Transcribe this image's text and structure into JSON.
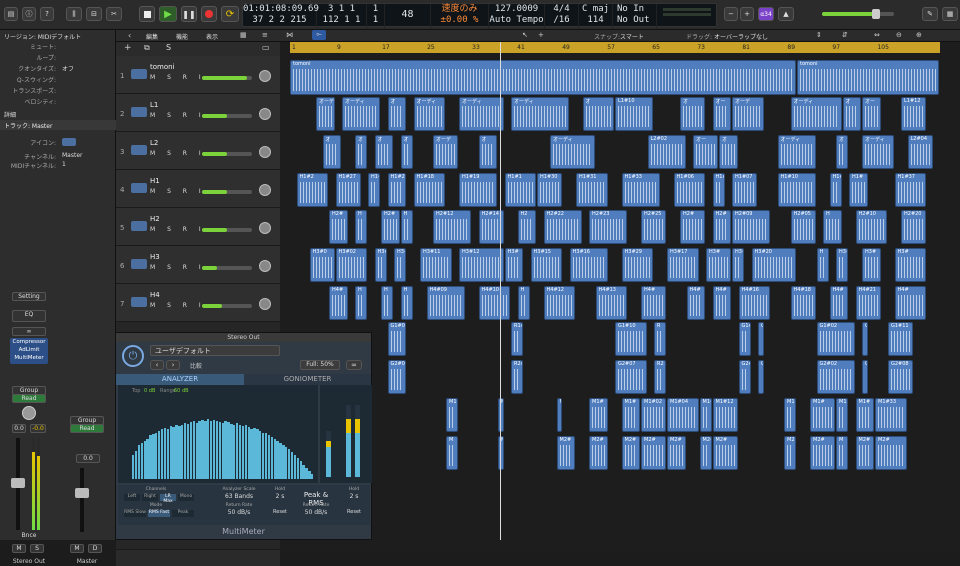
{
  "toolbar": {
    "transport": [
      "stop",
      "play",
      "pause",
      "record",
      "cycle"
    ],
    "lcd": {
      "smpte": "01:01:08:09.69",
      "bars": "37  2  2 215",
      "pos_top": "3  1  1",
      "pos_bottom": "112  1  1",
      "pos_extra_top": "1",
      "pos_extra_bottom": "1",
      "val": "48",
      "tempo_mode": "速度のみ",
      "tempo_offset": "±0.00 %",
      "tempo": "127.0009",
      "tempo_label": "Auto Tempo",
      "sig": "4/4",
      "div": "/16",
      "key": "C maj",
      "key_num": "114",
      "in": "No In",
      "out": "No Out"
    },
    "right_badge": "α34"
  },
  "menubar": {
    "items": [
      "編集",
      "機能",
      "表示"
    ],
    "snap_label": "スナップ:",
    "snap_value": "スマート",
    "drag_label": "ドラッグ:",
    "drag_value": "オーバーラップなし"
  },
  "ruler": {
    "ticks": [
      "1",
      "9",
      "17",
      "25",
      "33",
      "41",
      "49",
      "57",
      "65",
      "73",
      "81",
      "89",
      "97",
      "105"
    ]
  },
  "inspector": {
    "region_header": "リージョン: MIDIデフォルト",
    "rows": [
      {
        "k": "ミュート:",
        "v": ""
      },
      {
        "k": "ループ:",
        "v": ""
      },
      {
        "k": "クオンタイズ:",
        "v": "オフ"
      },
      {
        "k": "Q-スウィング:",
        "v": ""
      },
      {
        "k": "トランスポーズ:",
        "v": ""
      },
      {
        "k": "ベロシティ:",
        "v": ""
      }
    ],
    "more": "詳細",
    "track_header": "トラック: Master",
    "icon_label": "アイコン:",
    "channel_label": "チャンネル:",
    "channel_value": "Master",
    "midi_label": "MIDIチャンネル:",
    "midi_value": "1",
    "setting_btn": "Setting",
    "eq_btn": "EQ",
    "plugins": [
      "Compressor",
      "AdLimit",
      "MultiMeter"
    ],
    "strip1": {
      "group": "Group",
      "auto": "Read",
      "val1": "0.0",
      "val2": "-0.0",
      "bnce": "Bnce",
      "name": "Stereo Out",
      "m": "M",
      "s": "S"
    },
    "strip2": {
      "group": "Group",
      "auto": "Read",
      "val1": "0.0",
      "name": "Master",
      "m": "M",
      "d": "D"
    }
  },
  "tracks": [
    {
      "num": "1",
      "name": "tomoni",
      "vol": 0.9
    },
    {
      "num": "2",
      "name": "L1",
      "vol": 0.5
    },
    {
      "num": "3",
      "name": "L2",
      "vol": 0.5
    },
    {
      "num": "4",
      "name": "H1",
      "vol": 0.5
    },
    {
      "num": "5",
      "name": "H2",
      "vol": 0.5
    },
    {
      "num": "6",
      "name": "H3",
      "vol": 0.3
    },
    {
      "num": "7",
      "name": "H4",
      "vol": 0.4
    }
  ],
  "track_buttons": "M S R I",
  "regions": [
    {
      "lane": 0,
      "label": "tomoni",
      "start": 0.0,
      "end": 0.78
    },
    {
      "lane": 0,
      "label": "tomoni",
      "start": 0.78,
      "end": 1.0
    },
    {
      "lane": 1,
      "label": "オーデ",
      "start": 0.04,
      "end": 0.07
    },
    {
      "lane": 1,
      "label": "オーディ",
      "start": 0.08,
      "end": 0.14
    },
    {
      "lane": 1,
      "label": "オ",
      "start": 0.15,
      "end": 0.18
    },
    {
      "lane": 1,
      "label": "オーディ",
      "start": 0.19,
      "end": 0.24
    },
    {
      "lane": 1,
      "label": "オーディ",
      "start": 0.26,
      "end": 0.33
    },
    {
      "lane": 1,
      "label": "オーディ",
      "start": 0.34,
      "end": 0.43
    },
    {
      "lane": 1,
      "label": "オ",
      "start": 0.45,
      "end": 0.5
    },
    {
      "lane": 1,
      "label": "オーディ",
      "start": 0.51,
      "end": 0.56
    },
    {
      "lane": 1,
      "label": "L1#10",
      "start": 0.5,
      "end": 0.56
    },
    {
      "lane": 1,
      "label": "オ",
      "start": 0.6,
      "end": 0.64
    },
    {
      "lane": 1,
      "label": "オー",
      "start": 0.65,
      "end": 0.68
    },
    {
      "lane": 1,
      "label": "オーデ",
      "start": 0.68,
      "end": 0.73
    },
    {
      "lane": 1,
      "label": "オーディ",
      "start": 0.77,
      "end": 0.85
    },
    {
      "lane": 1,
      "label": "オ",
      "start": 0.85,
      "end": 0.88
    },
    {
      "lane": 1,
      "label": "オー",
      "start": 0.88,
      "end": 0.91
    },
    {
      "lane": 1,
      "label": "L1#12",
      "start": 0.94,
      "end": 0.98
    },
    {
      "lane": 2,
      "label": "オ",
      "start": 0.05,
      "end": 0.08
    },
    {
      "lane": 2,
      "label": "オ",
      "start": 0.1,
      "end": 0.12
    },
    {
      "lane": 2,
      "label": "オ",
      "start": 0.13,
      "end": 0.16
    },
    {
      "lane": 2,
      "label": "オ",
      "start": 0.17,
      "end": 0.19
    },
    {
      "lane": 2,
      "label": "オーデ",
      "start": 0.22,
      "end": 0.26
    },
    {
      "lane": 2,
      "label": "オ",
      "start": 0.29,
      "end": 0.32
    },
    {
      "lane": 2,
      "label": "オーディ",
      "start": 0.4,
      "end": 0.47
    },
    {
      "lane": 2,
      "label": "L2#02",
      "start": 0.55,
      "end": 0.61
    },
    {
      "lane": 2,
      "label": "オー",
      "start": 0.62,
      "end": 0.66
    },
    {
      "lane": 2,
      "label": "オ",
      "start": 0.66,
      "end": 0.69
    },
    {
      "lane": 2,
      "label": "オーディ",
      "start": 0.75,
      "end": 0.81
    },
    {
      "lane": 2,
      "label": "オ",
      "start": 0.84,
      "end": 0.86
    },
    {
      "lane": 2,
      "label": "オーディ",
      "start": 0.88,
      "end": 0.93
    },
    {
      "lane": 2,
      "label": "L2#04",
      "start": 0.95,
      "end": 0.99
    },
    {
      "lane": 3,
      "label": "H1#2",
      "start": 0.01,
      "end": 0.06
    },
    {
      "lane": 3,
      "label": "H1#27",
      "start": 0.07,
      "end": 0.11
    },
    {
      "lane": 3,
      "label": "H1#",
      "start": 0.12,
      "end": 0.14
    },
    {
      "lane": 3,
      "label": "H1#2",
      "start": 0.15,
      "end": 0.18
    },
    {
      "lane": 3,
      "label": "H1#18",
      "start": 0.19,
      "end": 0.24
    },
    {
      "lane": 3,
      "label": "H1#19",
      "start": 0.26,
      "end": 0.32
    },
    {
      "lane": 3,
      "label": "H1#1",
      "start": 0.33,
      "end": 0.38
    },
    {
      "lane": 3,
      "label": "H1#30",
      "start": 0.38,
      "end": 0.42
    },
    {
      "lane": 3,
      "label": "H1#31",
      "start": 0.44,
      "end": 0.49
    },
    {
      "lane": 3,
      "label": "H1#33",
      "start": 0.51,
      "end": 0.57
    },
    {
      "lane": 3,
      "label": "H1#06",
      "start": 0.59,
      "end": 0.64
    },
    {
      "lane": 3,
      "label": "H1#",
      "start": 0.65,
      "end": 0.67
    },
    {
      "lane": 3,
      "label": "H1#07",
      "start": 0.68,
      "end": 0.72
    },
    {
      "lane": 3,
      "label": "H1#10",
      "start": 0.75,
      "end": 0.81
    },
    {
      "lane": 3,
      "label": "H1#",
      "start": 0.83,
      "end": 0.85
    },
    {
      "lane": 3,
      "label": "H1#",
      "start": 0.86,
      "end": 0.89
    },
    {
      "lane": 3,
      "label": "H1#37",
      "start": 0.93,
      "end": 0.98
    },
    {
      "lane": 4,
      "label": "H2#",
      "start": 0.06,
      "end": 0.09
    },
    {
      "lane": 4,
      "label": "H",
      "start": 0.1,
      "end": 0.12
    },
    {
      "lane": 4,
      "label": "H2#",
      "start": 0.14,
      "end": 0.17
    },
    {
      "lane": 4,
      "label": "H",
      "start": 0.17,
      "end": 0.19
    },
    {
      "lane": 4,
      "label": "H2#12",
      "start": 0.22,
      "end": 0.28
    },
    {
      "lane": 4,
      "label": "H2#14",
      "start": 0.29,
      "end": 0.33
    },
    {
      "lane": 4,
      "label": "H2",
      "start": 0.35,
      "end": 0.38
    },
    {
      "lane": 4,
      "label": "H2#22",
      "start": 0.39,
      "end": 0.45
    },
    {
      "lane": 4,
      "label": "H2#23",
      "start": 0.46,
      "end": 0.52
    },
    {
      "lane": 4,
      "label": "H2#25",
      "start": 0.54,
      "end": 0.58
    },
    {
      "lane": 4,
      "label": "H2#",
      "start": 0.6,
      "end": 0.64
    },
    {
      "lane": 4,
      "label": "H2#",
      "start": 0.65,
      "end": 0.68
    },
    {
      "lane": 4,
      "label": "H2#09",
      "start": 0.68,
      "end": 0.74
    },
    {
      "lane": 4,
      "label": "H2#05",
      "start": 0.77,
      "end": 0.81
    },
    {
      "lane": 4,
      "label": "H",
      "start": 0.82,
      "end": 0.85
    },
    {
      "lane": 4,
      "label": "H2#10",
      "start": 0.87,
      "end": 0.92
    },
    {
      "lane": 4,
      "label": "H2#20",
      "start": 0.94,
      "end": 0.98
    },
    {
      "lane": 5,
      "label": "H3#0",
      "start": 0.03,
      "end": 0.07
    },
    {
      "lane": 5,
      "label": "H3#02",
      "start": 0.07,
      "end": 0.12
    },
    {
      "lane": 5,
      "label": "H3#",
      "start": 0.13,
      "end": 0.15
    },
    {
      "lane": 5,
      "label": "H3#",
      "start": 0.16,
      "end": 0.18
    },
    {
      "lane": 5,
      "label": "H3#11",
      "start": 0.2,
      "end": 0.25
    },
    {
      "lane": 5,
      "label": "H3#12",
      "start": 0.26,
      "end": 0.33
    },
    {
      "lane": 5,
      "label": "H3#",
      "start": 0.33,
      "end": 0.36
    },
    {
      "lane": 5,
      "label": "H3#15",
      "start": 0.37,
      "end": 0.42
    },
    {
      "lane": 5,
      "label": "H3#16",
      "start": 0.43,
      "end": 0.49
    },
    {
      "lane": 5,
      "label": "H3#29",
      "start": 0.51,
      "end": 0.56
    },
    {
      "lane": 5,
      "label": "H3#17",
      "start": 0.58,
      "end": 0.63
    },
    {
      "lane": 5,
      "label": "H3#",
      "start": 0.64,
      "end": 0.68
    },
    {
      "lane": 5,
      "label": "H3#",
      "start": 0.68,
      "end": 0.7
    },
    {
      "lane": 5,
      "label": "H3#20",
      "start": 0.71,
      "end": 0.78
    },
    {
      "lane": 5,
      "label": "H",
      "start": 0.81,
      "end": 0.83
    },
    {
      "lane": 5,
      "label": "H3#",
      "start": 0.84,
      "end": 0.86
    },
    {
      "lane": 5,
      "label": "H3#",
      "start": 0.88,
      "end": 0.91
    },
    {
      "lane": 5,
      "label": "H3#",
      "start": 0.93,
      "end": 0.98
    },
    {
      "lane": 6,
      "label": "H4#",
      "start": 0.06,
      "end": 0.09
    },
    {
      "lane": 6,
      "label": "H",
      "start": 0.1,
      "end": 0.12
    },
    {
      "lane": 6,
      "label": "H",
      "start": 0.14,
      "end": 0.16
    },
    {
      "lane": 6,
      "label": "H",
      "start": 0.17,
      "end": 0.19
    },
    {
      "lane": 6,
      "label": "H4#09",
      "start": 0.21,
      "end": 0.27
    },
    {
      "lane": 6,
      "label": "H4#10",
      "start": 0.29,
      "end": 0.34
    },
    {
      "lane": 6,
      "label": "H",
      "start": 0.35,
      "end": 0.37
    },
    {
      "lane": 6,
      "label": "H4#12",
      "start": 0.39,
      "end": 0.44
    },
    {
      "lane": 6,
      "label": "H4#13",
      "start": 0.47,
      "end": 0.52
    },
    {
      "lane": 6,
      "label": "H4#",
      "start": 0.54,
      "end": 0.58
    },
    {
      "lane": 6,
      "label": "H4#",
      "start": 0.61,
      "end": 0.64
    },
    {
      "lane": 6,
      "label": "H4#",
      "start": 0.65,
      "end": 0.68
    },
    {
      "lane": 6,
      "label": "H4#16",
      "start": 0.69,
      "end": 0.74
    },
    {
      "lane": 6,
      "label": "H4#18",
      "start": 0.77,
      "end": 0.81
    },
    {
      "lane": 6,
      "label": "H4#",
      "start": 0.83,
      "end": 0.86
    },
    {
      "lane": 6,
      "label": "H4#21",
      "start": 0.87,
      "end": 0.91
    },
    {
      "lane": 6,
      "label": "H4#",
      "start": 0.93,
      "end": 0.98
    },
    {
      "lane": 7,
      "label": "G1#04",
      "start": 0.15,
      "end": 0.18
    },
    {
      "lane": 7,
      "label": "R1#",
      "start": 0.34,
      "end": 0.36
    },
    {
      "lane": 7,
      "label": "G1#10",
      "start": 0.5,
      "end": 0.55
    },
    {
      "lane": 7,
      "label": "R",
      "start": 0.56,
      "end": 0.58
    },
    {
      "lane": 7,
      "label": "G1#",
      "start": 0.69,
      "end": 0.71
    },
    {
      "lane": 7,
      "label": "G",
      "start": 0.72,
      "end": 0.73
    },
    {
      "lane": 7,
      "label": "G1#02",
      "start": 0.81,
      "end": 0.87
    },
    {
      "lane": 7,
      "label": "G",
      "start": 0.88,
      "end": 0.89
    },
    {
      "lane": 7,
      "label": "G1#11",
      "start": 0.92,
      "end": 0.96
    },
    {
      "lane": 8,
      "label": "G2#04",
      "start": 0.15,
      "end": 0.18
    },
    {
      "lane": 8,
      "label": "R2#",
      "start": 0.34,
      "end": 0.36
    },
    {
      "lane": 8,
      "label": "G2#07",
      "start": 0.5,
      "end": 0.55
    },
    {
      "lane": 8,
      "label": "R2",
      "start": 0.56,
      "end": 0.58
    },
    {
      "lane": 8,
      "label": "G2#",
      "start": 0.69,
      "end": 0.71
    },
    {
      "lane": 8,
      "label": "G",
      "start": 0.72,
      "end": 0.73
    },
    {
      "lane": 8,
      "label": "G2#02",
      "start": 0.81,
      "end": 0.87
    },
    {
      "lane": 8,
      "label": "G",
      "start": 0.88,
      "end": 0.89
    },
    {
      "lane": 8,
      "label": "G2#08",
      "start": 0.92,
      "end": 0.96
    },
    {
      "lane": 9,
      "label": "M1",
      "start": 0.24,
      "end": 0.26
    },
    {
      "lane": 9,
      "label": "M1",
      "start": 0.32,
      "end": 0.33
    },
    {
      "lane": 9,
      "label": "M1",
      "start": 0.41,
      "end": 0.42
    },
    {
      "lane": 9,
      "label": "M1#",
      "start": 0.46,
      "end": 0.49
    },
    {
      "lane": 9,
      "label": "M1#",
      "start": 0.51,
      "end": 0.54
    },
    {
      "lane": 9,
      "label": "M1#02",
      "start": 0.54,
      "end": 0.58
    },
    {
      "lane": 9,
      "label": "M1#04",
      "start": 0.58,
      "end": 0.63
    },
    {
      "lane": 9,
      "label": "M1#",
      "start": 0.63,
      "end": 0.65
    },
    {
      "lane": 9,
      "label": "M1#12",
      "start": 0.65,
      "end": 0.69
    },
    {
      "lane": 9,
      "label": "M1",
      "start": 0.76,
      "end": 0.78
    },
    {
      "lane": 9,
      "label": "M1#",
      "start": 0.8,
      "end": 0.84
    },
    {
      "lane": 9,
      "label": "M1",
      "start": 0.84,
      "end": 0.86
    },
    {
      "lane": 9,
      "label": "M1#",
      "start": 0.87,
      "end": 0.9
    },
    {
      "lane": 9,
      "label": "M1#33",
      "start": 0.9,
      "end": 0.95
    },
    {
      "lane": 10,
      "label": "M",
      "start": 0.24,
      "end": 0.26
    },
    {
      "lane": 10,
      "label": "M",
      "start": 0.32,
      "end": 0.33
    },
    {
      "lane": 10,
      "label": "M2#",
      "start": 0.41,
      "end": 0.44
    },
    {
      "lane": 10,
      "label": "M2#",
      "start": 0.46,
      "end": 0.49
    },
    {
      "lane": 10,
      "label": "M2#",
      "start": 0.51,
      "end": 0.54
    },
    {
      "lane": 10,
      "label": "M2#",
      "start": 0.54,
      "end": 0.58
    },
    {
      "lane": 10,
      "label": "M2#",
      "start": 0.58,
      "end": 0.61
    },
    {
      "lane": 10,
      "label": "M2#",
      "start": 0.63,
      "end": 0.65
    },
    {
      "lane": 10,
      "label": "M2#",
      "start": 0.65,
      "end": 0.69
    },
    {
      "lane": 10,
      "label": "M2",
      "start": 0.76,
      "end": 0.78
    },
    {
      "lane": 10,
      "label": "M2#",
      "start": 0.8,
      "end": 0.84
    },
    {
      "lane": 10,
      "label": "M",
      "start": 0.84,
      "end": 0.86
    },
    {
      "lane": 10,
      "label": "M2#",
      "start": 0.87,
      "end": 0.9
    },
    {
      "lane": 10,
      "label": "M2#",
      "start": 0.9,
      "end": 0.95
    }
  ],
  "multimeter": {
    "title": "Stereo Out",
    "preset": "ユーザデフォルト",
    "compare": "比較",
    "zoom": "Full: 50%",
    "tab_analyzer": "ANALYZER",
    "tab_gonio": "GONIOMETER",
    "top_label": "Top",
    "top_value": "0 dB",
    "range_label": "Range",
    "range_value": "60 dB",
    "bottom_controls": [
      {
        "label": "Channels",
        "opts": [
          "Left",
          "Right",
          "LR Max",
          "Mono"
        ],
        "active": 2
      },
      {
        "label": "Mode",
        "opts": [
          "RMS Slow",
          "RMS Fast",
          "Peak"
        ],
        "active": 1
      },
      {
        "label": "Analyzer Scale",
        "value": "63 Bands"
      },
      {
        "label": "Return Rate",
        "value": "50 dB/s"
      },
      {
        "label": "Hold",
        "value": "2 s"
      },
      {
        "label": "Meter",
        "value": "Peak & RMS"
      },
      {
        "label": "Hold",
        "value": "2 s"
      },
      {
        "label": "Return Rate",
        "value": "50 dB/s"
      }
    ],
    "reset": "Reset",
    "footer": "MultiMeter",
    "analyzer_bars": [
      0.3,
      0.35,
      0.42,
      0.45,
      0.48,
      0.5,
      0.55,
      0.56,
      0.58,
      0.6,
      0.62,
      0.64,
      0.63,
      0.66,
      0.65,
      0.67,
      0.66,
      0.68,
      0.7,
      0.69,
      0.71,
      0.72,
      0.7,
      0.73,
      0.74,
      0.72,
      0.75,
      0.73,
      0.74,
      0.72,
      0.71,
      0.7,
      0.72,
      0.71,
      0.69,
      0.68,
      0.7,
      0.67,
      0.66,
      0.68,
      0.65,
      0.63,
      0.64,
      0.62,
      0.6,
      0.58,
      0.57,
      0.55,
      0.52,
      0.5,
      0.48,
      0.45,
      0.42,
      0.4,
      0.37,
      0.34,
      0.3,
      0.26,
      0.22,
      0.18,
      0.14,
      0.1,
      0.06
    ]
  }
}
